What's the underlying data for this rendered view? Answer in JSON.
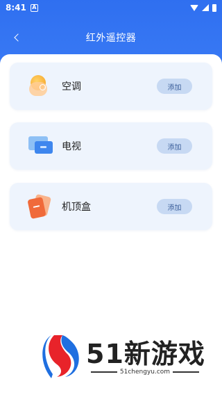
{
  "status_bar": {
    "time": "8:41",
    "notification_icon": "A"
  },
  "nav": {
    "title": "红外遥控器"
  },
  "devices": [
    {
      "label": "空调",
      "icon": "air-conditioner-icon",
      "button": "添加"
    },
    {
      "label": "电视",
      "icon": "tv-icon",
      "button": "添加"
    },
    {
      "label": "机顶盒",
      "icon": "set-top-box-icon",
      "button": "添加"
    }
  ],
  "watermark": {
    "brand": "51新游戏",
    "site": "51chengyu.com"
  },
  "colors": {
    "header": "#2f6ff0",
    "card_bg": "#eef4fd",
    "button_bg": "#c7d9f3",
    "button_text": "#3a5e9a"
  }
}
